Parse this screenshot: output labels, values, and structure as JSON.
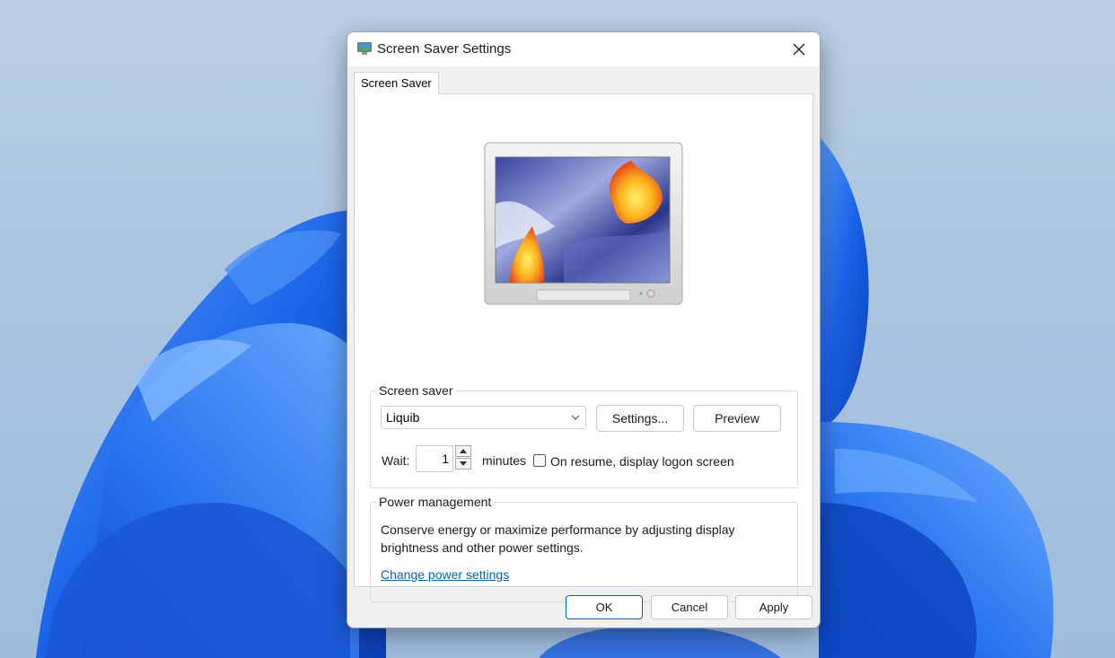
{
  "window": {
    "title": "Screen Saver Settings"
  },
  "tabs": [
    {
      "label": "Screen Saver"
    }
  ],
  "screensaver": {
    "group_label": "Screen saver",
    "selected": "Liquib",
    "settings_label": "Settings...",
    "preview_label": "Preview",
    "wait_label": "Wait:",
    "wait_value": "1",
    "minutes_label": "minutes",
    "logon_label": "On resume, display logon screen",
    "logon_checked": false
  },
  "power": {
    "group_label": "Power management",
    "description": "Conserve energy or maximize performance by adjusting display brightness and other power settings.",
    "link": "Change power settings"
  },
  "buttons": {
    "ok": "OK",
    "cancel": "Cancel",
    "apply": "Apply"
  },
  "colors": {
    "accent": "#0067b8",
    "wallpaper": "#1b66e6",
    "dialog_bg": "#f0f0f0"
  }
}
